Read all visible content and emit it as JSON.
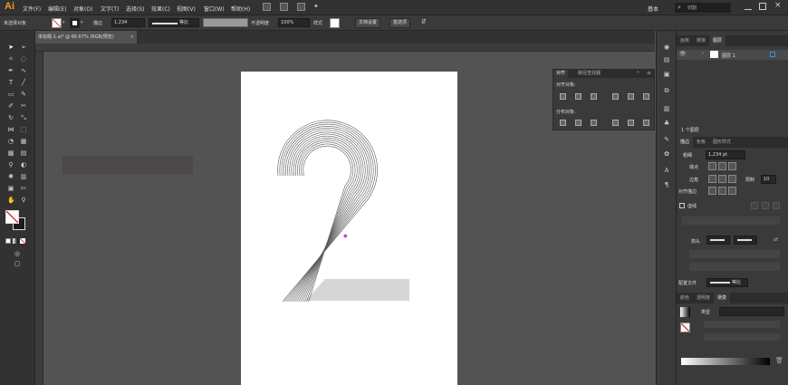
{
  "app": {
    "logo": "Ai"
  },
  "menubar": {
    "items": [
      "文件(F)",
      "编辑(E)",
      "对象(O)",
      "文字(T)",
      "选择(S)",
      "效果(C)",
      "视图(V)",
      "窗口(W)",
      "帮助(H)"
    ],
    "layout_label": "基本",
    "search_placeholder": "切割"
  },
  "control_bar": {
    "selection_label": "未选择对象",
    "stroke_label": "描边",
    "stroke_weight": "1.234",
    "stroke_profile": "等比",
    "opacity_label": "不透明度",
    "opacity_value": "100%",
    "style_label": "样式",
    "doc_setup": "文档设置",
    "preferences": "首选项"
  },
  "document": {
    "tab_label": "未标题-1.ai* @ 66.67% (RGB/预览)",
    "artwork_glyph": "2"
  },
  "align_panel": {
    "tab_align": "对齐",
    "tab_pathfinder": "路径查找器",
    "align_objects": "对齐对象:",
    "distribute_objects": "分布对象:"
  },
  "layers_panel": {
    "tabs": [
      "画板",
      "链接",
      "图层"
    ],
    "layer_name": "图层 1",
    "footer": "1 个图层"
  },
  "stroke_panel": {
    "tabs": [
      "描边",
      "色板",
      "图形样式"
    ],
    "weight_label": "粗细",
    "weight_value": "1.234 pt",
    "cap_label": "端点",
    "corner_label": "边角",
    "limit_label": "限制",
    "limit_value": "10",
    "align_label": "对齐描边",
    "dashed_label": "虚线",
    "arrow_label": "箭头",
    "profile_label": "配置文件",
    "profile_value": "等比"
  },
  "gradient_panel": {
    "tabs": [
      "颜色",
      "透明度",
      "渐变"
    ],
    "type_label": "类型"
  },
  "colors": {
    "accent": "#f29a1e",
    "canvas": "#535353",
    "panel": "#3a3a3a",
    "artwork_stroke": "#5a5a5a",
    "anchor": "#c43ac4"
  }
}
